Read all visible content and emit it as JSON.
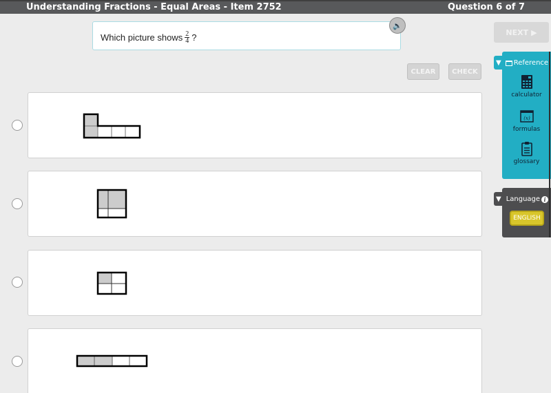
{
  "header": {
    "title": "Understanding Fractions - Equal Areas - Item 2752",
    "progress": "Question 6 of 7"
  },
  "question": {
    "prefix": "Which picture shows",
    "fraction_numerator": "2",
    "fraction_denominator": "4",
    "suffix": "?"
  },
  "icons": {
    "audio": "speaker-icon",
    "next": "play-triangle-icon",
    "collapse": "triangle-down-icon",
    "reference": "window-icon",
    "calculator": "calculator-icon",
    "formulas": "formula-icon",
    "glossary": "clipboard-icon",
    "info": "info-icon"
  },
  "buttons": {
    "next": "NEXT",
    "next_arrow": "▶",
    "clear": "CLEAR",
    "check": "CHECK"
  },
  "options": [
    {
      "id": "A",
      "description": "L-shape of 5 squares, 2 shaded",
      "selected": false
    },
    {
      "id": "B",
      "description": "Square split into 4 unequal parts, 2 large top parts shaded",
      "selected": false
    },
    {
      "id": "C",
      "description": "Rectangle split into 4 parts, 1 shaded",
      "selected": false
    },
    {
      "id": "D",
      "description": "Strip of 4 equal parts, 2 shaded",
      "selected": false
    }
  ],
  "reference": {
    "title": "Reference",
    "items": [
      {
        "label": "calculator"
      },
      {
        "label": "formulas"
      },
      {
        "label": "glossary"
      }
    ]
  },
  "language": {
    "title": "Language",
    "current": "ENGLISH"
  },
  "colors": {
    "header_bg": "#58595b",
    "reference_bg": "#22aec4",
    "language_bg": "#4d4d4f",
    "language_button": "#d9c62b",
    "shaded_cell": "#cccccc"
  }
}
